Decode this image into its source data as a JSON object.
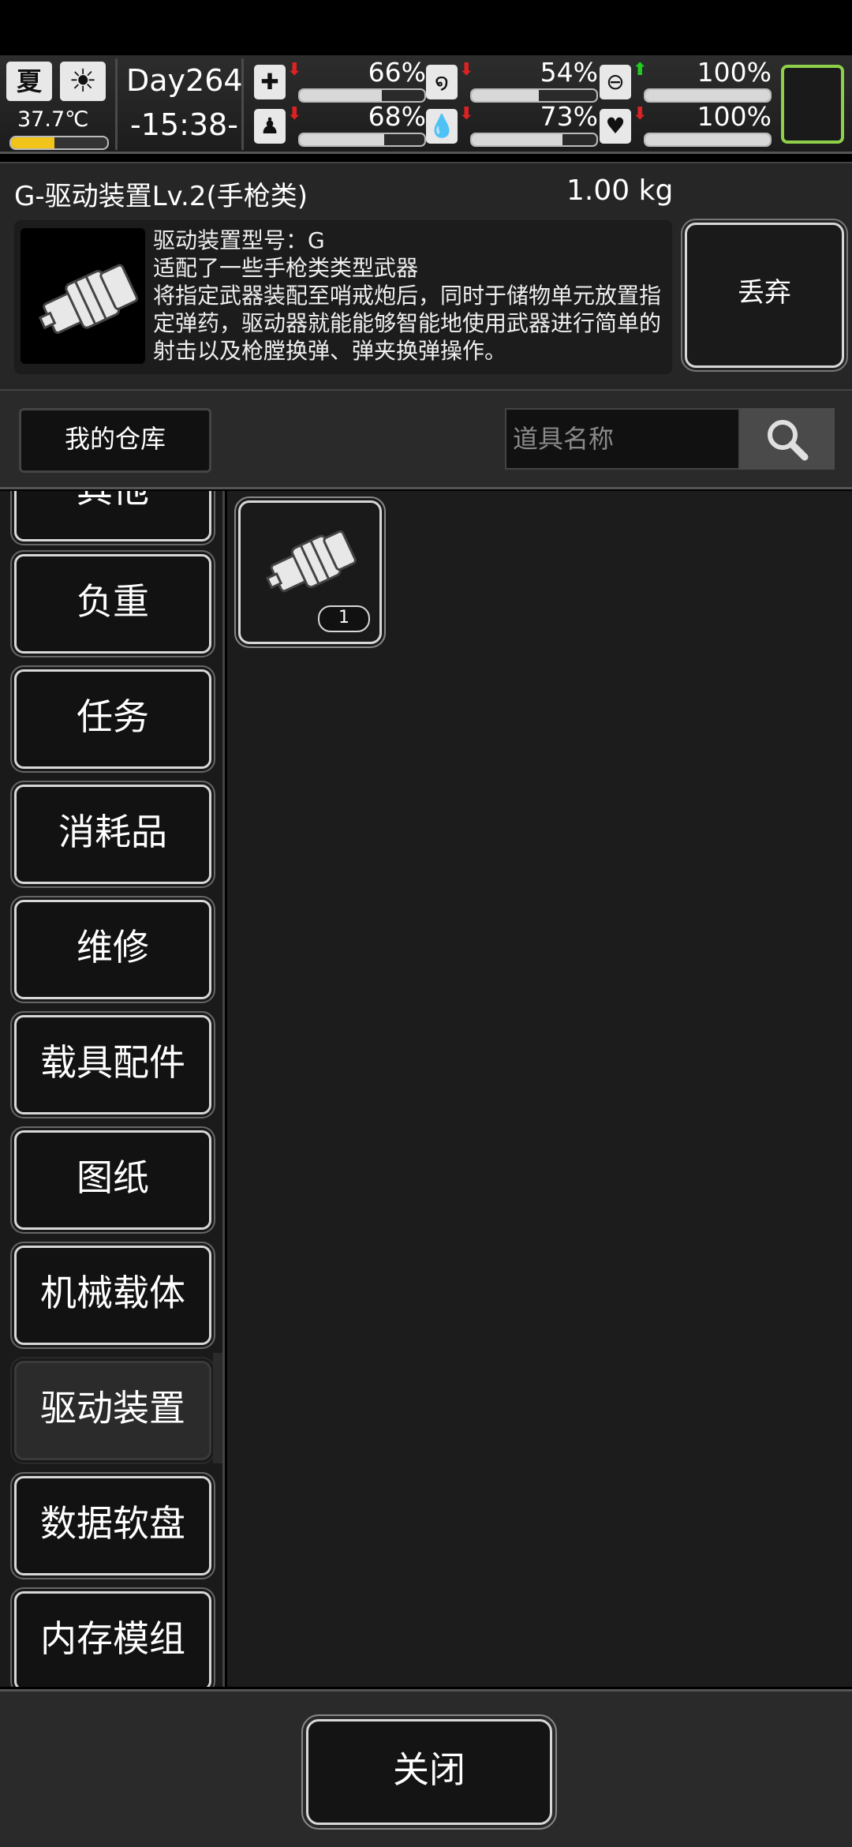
{
  "status": {
    "season": "夏",
    "temperature": "37.7℃",
    "temperature_level": 0.45,
    "day": "Day264",
    "time": "-15:38-",
    "stats": [
      {
        "icon": "health-icon",
        "trend": "down",
        "percent": "66%",
        "fill": 0.66
      },
      {
        "icon": "stomach-icon",
        "trend": "down",
        "percent": "54%",
        "fill": 0.54
      },
      {
        "icon": "pill-icon",
        "trend": "up",
        "percent": "100%",
        "fill": 1.0
      },
      {
        "icon": "foot-icon",
        "trend": "down",
        "percent": "68%",
        "fill": 0.68
      },
      {
        "icon": "water-drop-icon",
        "trend": "down",
        "percent": "73%",
        "fill": 0.73
      },
      {
        "icon": "heart-icon",
        "trend": "down",
        "percent": "100%",
        "fill": 1.0
      }
    ],
    "colors": {
      "up": "#22cc22",
      "down": "#dd2222",
      "temp_fill": "#f0c419",
      "frame": "#8fd04a"
    }
  },
  "item": {
    "title": "G-驱动装置Lv.2(手枪类)",
    "weight": "1.00 kg",
    "description": "驱动装置型号：G\n适配了一些手枪类类型武器\n将指定武器装配至哨戒炮后，同时于储物单元放置指定弹药，驱动器就能能够智能地使用武器进行简单的射击以及枪膛换弹、弹夹换弹操作。",
    "discard_label": "丢弃"
  },
  "warehouse": {
    "label": "我的仓库",
    "search_placeholder": "道具名称"
  },
  "categories": [
    {
      "label": "其他",
      "active": false
    },
    {
      "label": "负重",
      "active": false
    },
    {
      "label": "任务",
      "active": false
    },
    {
      "label": "消耗品",
      "active": false
    },
    {
      "label": "维修",
      "active": false
    },
    {
      "label": "载具配件",
      "active": false
    },
    {
      "label": "图纸",
      "active": false
    },
    {
      "label": "机械载体",
      "active": false
    },
    {
      "label": "驱动装置",
      "active": true
    },
    {
      "label": "数据软盘",
      "active": false
    },
    {
      "label": "内存模组",
      "active": false
    }
  ],
  "inventory": [
    {
      "icon": "drive-device-icon",
      "quantity": "1"
    }
  ],
  "close_label": "关闭"
}
